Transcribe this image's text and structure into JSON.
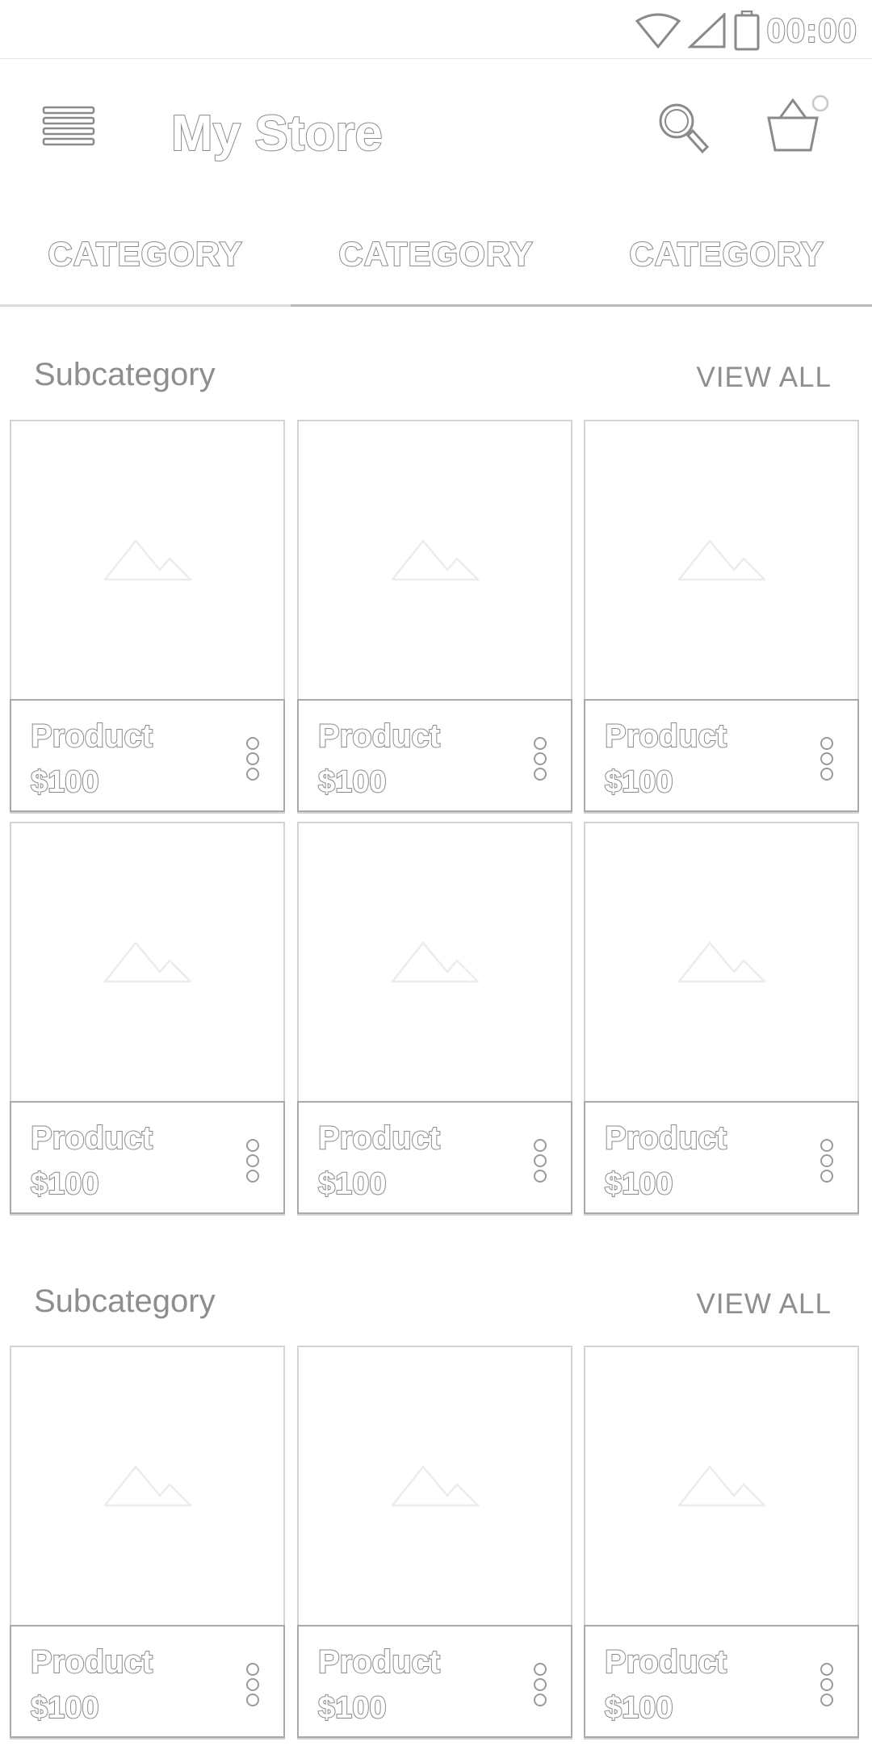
{
  "status_bar": {
    "time": "00:00",
    "icons": [
      "wifi-icon",
      "signal-icon",
      "battery-icon"
    ]
  },
  "app_bar": {
    "title": "My Store",
    "icons": [
      "menu-icon",
      "search-icon",
      "cart-icon"
    ]
  },
  "tabs": [
    {
      "label": "CATEGORY",
      "selected": true
    },
    {
      "label": "CATEGORY",
      "selected": false
    },
    {
      "label": "CATEGORY",
      "selected": false
    }
  ],
  "sections": [
    {
      "title": "Subcategory",
      "view_all": "VIEW ALL",
      "products": [
        {
          "name": "Product",
          "price": "$100"
        },
        {
          "name": "Product",
          "price": "$100"
        },
        {
          "name": "Product",
          "price": "$100"
        },
        {
          "name": "Product",
          "price": "$100"
        },
        {
          "name": "Product",
          "price": "$100"
        },
        {
          "name": "Product",
          "price": "$100"
        }
      ]
    },
    {
      "title": "Subcategory",
      "view_all": "VIEW ALL",
      "products": [
        {
          "name": "Product",
          "price": "$100"
        },
        {
          "name": "Product",
          "price": "$100"
        },
        {
          "name": "Product",
          "price": "$100"
        }
      ]
    }
  ],
  "colors": {
    "background": "#ffffff",
    "outline_text": "#8a8a8a",
    "card_border": "#d3d3d3",
    "footer_border": "#a9a9a9"
  }
}
